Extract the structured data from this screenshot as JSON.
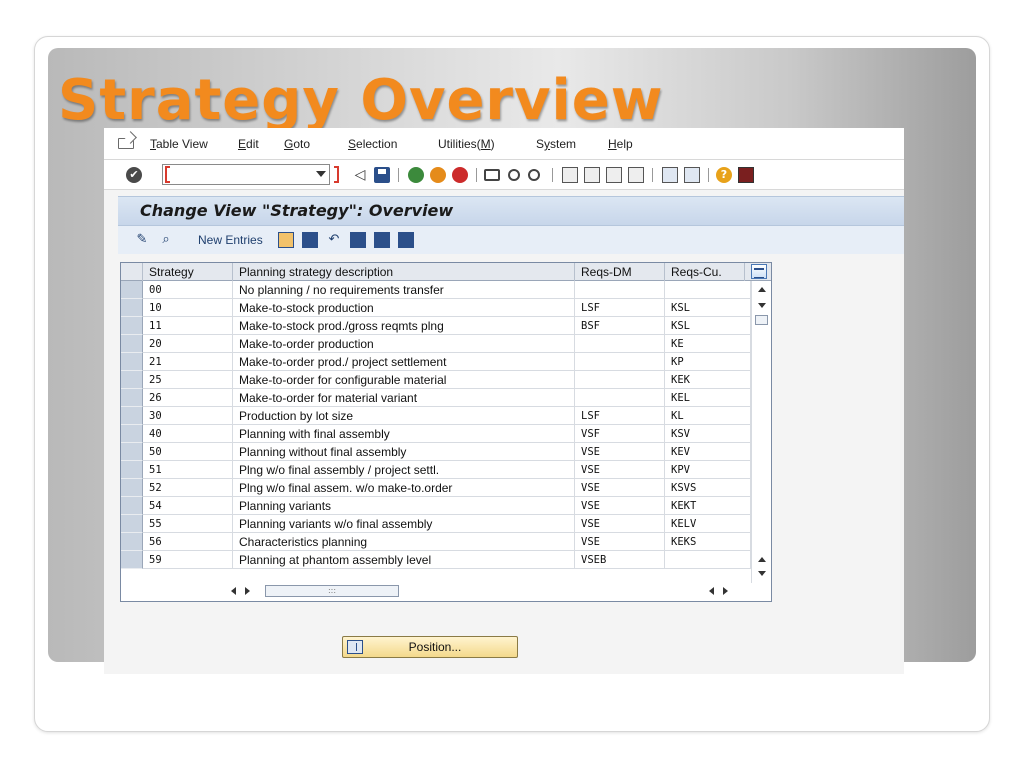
{
  "slide": {
    "title": "Strategy Overview"
  },
  "menubar": {
    "items": [
      {
        "prefix": "",
        "underline": "T",
        "rest": "able View"
      },
      {
        "prefix": "",
        "underline": "E",
        "rest": "dit"
      },
      {
        "prefix": "",
        "underline": "G",
        "rest": "oto"
      },
      {
        "prefix": "",
        "underline": "S",
        "rest": "election"
      },
      {
        "prefix": "Utilities(",
        "underline": "M",
        "rest": ")"
      },
      {
        "prefix": "S",
        "underline": "y",
        "rest": "stem"
      },
      {
        "prefix": "",
        "underline": "H",
        "rest": "elp"
      }
    ]
  },
  "toolbar": {
    "command_field_value": ""
  },
  "screen": {
    "title": "Change View \"Strategy\": Overview",
    "new_entries_label": "New Entries"
  },
  "table": {
    "headers": [
      "Strategy",
      "Planning strategy description",
      "Reqs-DM",
      "Reqs-Cu."
    ],
    "rows": [
      [
        "00",
        "No planning / no requirements transfer",
        "",
        ""
      ],
      [
        "10",
        "Make-to-stock production",
        "LSF",
        "KSL"
      ],
      [
        "11",
        "Make-to-stock prod./gross reqmts plng",
        "BSF",
        "KSL"
      ],
      [
        "20",
        "Make-to-order production",
        "",
        "KE"
      ],
      [
        "21",
        "Make-to-order prod./ project settlement",
        "",
        "KP"
      ],
      [
        "25",
        "Make-to-order for configurable material",
        "",
        "KEK"
      ],
      [
        "26",
        "Make-to-order for material variant",
        "",
        "KEL"
      ],
      [
        "30",
        "Production by lot size",
        "LSF",
        "KL"
      ],
      [
        "40",
        "Planning with final assembly",
        "VSF",
        "KSV"
      ],
      [
        "50",
        "Planning without final assembly",
        "VSE",
        "KEV"
      ],
      [
        "51",
        "Plng w/o final assembly / project settl.",
        "VSE",
        "KPV"
      ],
      [
        "52",
        "Plng w/o final assem. w/o make-to.order",
        "VSE",
        "KSVS"
      ],
      [
        "54",
        "Planning variants",
        "VSE",
        "KEKT"
      ],
      [
        "55",
        "Planning variants w/o final assembly",
        "VSE",
        "KELV"
      ],
      [
        "56",
        "Characteristics planning",
        "VSE",
        "KEKS"
      ],
      [
        "59",
        "Planning at phantom assembly level",
        "VSEB",
        ""
      ]
    ],
    "scroll_thumb_glyph": ":::"
  },
  "position_button": {
    "label": "Position..."
  },
  "icons": {
    "menu": "menu-icon",
    "enter": "checkmark-icon",
    "back": "back-icon",
    "save": "save-icon",
    "toggle_change": "edit-toggle-icon",
    "details": "details-icon"
  },
  "colors": {
    "title_orange": "#f28a1e",
    "header_blue": "#c7d6ea",
    "button_yellow": "#f4d98c"
  }
}
